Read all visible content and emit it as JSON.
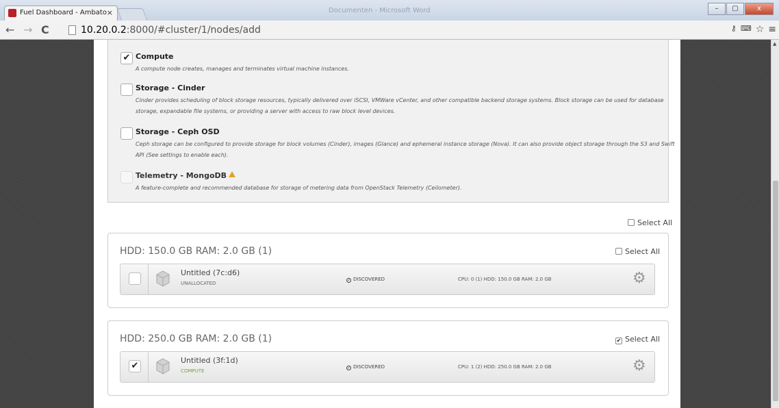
{
  "browser": {
    "tab_title": "Fuel Dashboard - Ambato",
    "tab_close": "×",
    "window_title": "Documenten - Microsoft Word",
    "win_min": "–",
    "win_max": "▢",
    "win_close": "x",
    "back": "←",
    "forward": "→",
    "reload": "C",
    "url_host": "10.20.0.2",
    "url_path": ":8000/#cluster/1/nodes/add",
    "icon_key": "key-icon",
    "icon_translate": "translate-icon",
    "icon_star": "☆",
    "icon_menu": "≡"
  },
  "roles": [
    {
      "title": "Compute",
      "desc": "A compute node creates, manages and terminates virtual machine instances.",
      "checked": "✔"
    },
    {
      "title": "Storage - Cinder",
      "desc": "Cinder provides scheduling of block storage resources, typically delivered over iSCSI, VMWare vCenter, and other compatible backend storage systems. Block storage can be used for database storage, expandable file systems, or providing a server with access to raw block level devices.",
      "checked": ""
    },
    {
      "title": "Storage - Ceph OSD",
      "desc": "Ceph storage can be configured to provide storage for block volumes (Cinder), images (Glance) and ephemeral instance storage (Nova). It can also provide object storage through the S3 and Swift API (See settings to enable each).",
      "checked": ""
    },
    {
      "title": "Telemetry - MongoDB",
      "desc": "A feature-complete and recommended database for storage of metering data from OpenStack Telemetry (Ceilometer).",
      "checked": ""
    }
  ],
  "select_all_label": "Select All",
  "groups": [
    {
      "title": "HDD: 150.0 GB  RAM: 2.0 GB (1)",
      "select_all_checked": "",
      "node": {
        "checked": "",
        "name": "Untitled (7c:d6)",
        "role": "UNALLOCATED",
        "status": "DISCOVERED",
        "specs": "CPU: 0 (1)    HDD: 150.0 GB    RAM: 2.0 GB"
      }
    },
    {
      "title": "HDD: 250.0 GB  RAM: 2.0 GB (1)",
      "select_all_checked": "✔",
      "node": {
        "checked": "✔",
        "name": "Untitled (3f:1d)",
        "role": "COMPUTE",
        "status": "DISCOVERED",
        "specs": "CPU: 1 (2)    HDD: 250.0 GB    RAM: 2.0 GB"
      }
    }
  ],
  "gear_glyph": "⚙",
  "status_glyph": "✓"
}
